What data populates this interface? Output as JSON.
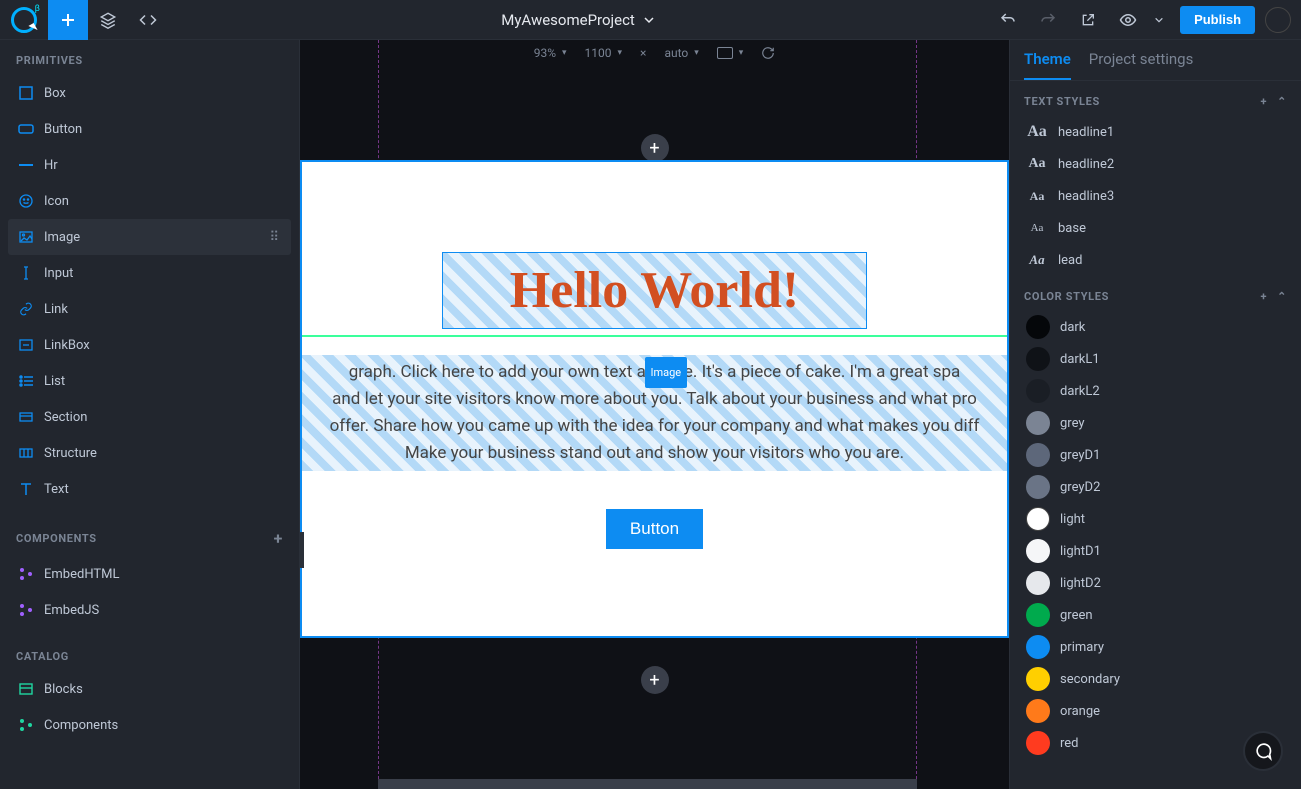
{
  "topbar": {
    "project_name": "MyAwesomeProject",
    "publish_label": "Publish",
    "logo_beta": "β"
  },
  "canvas_toolbar": {
    "zoom": "93%",
    "width": "1100",
    "times": "×",
    "height": "auto"
  },
  "left": {
    "primitives_heading": "PRIMITIVES",
    "components_heading": "COMPONENTS",
    "catalog_heading": "CATALOG",
    "primitives": [
      "Box",
      "Button",
      "Hr",
      "Icon",
      "Image",
      "Input",
      "Link",
      "LinkBox",
      "List",
      "Section",
      "Structure",
      "Text"
    ],
    "components": [
      "EmbedHTML",
      "EmbedJS"
    ],
    "catalog": [
      "Blocks",
      "Components"
    ]
  },
  "canvas": {
    "headline": "Hello World!",
    "drag_label": "Image",
    "paragraph": "graph. Click here to add your own text and           me. It's a piece of cake. I'm a great spa\nand let your site visitors know more about you. Talk about your business and what pro\noffer. Share how you came up with the idea for your company and what makes you diff\nMake your business stand out and show your visitors who you are.",
    "button_label": "Button"
  },
  "right": {
    "tabs": {
      "theme": "Theme",
      "settings": "Project settings"
    },
    "text_styles_heading": "TEXT STYLES",
    "text_styles": [
      "headline1",
      "headline2",
      "headline3",
      "base",
      "lead"
    ],
    "color_styles_heading": "COLOR STYLES",
    "color_styles": [
      {
        "name": "dark",
        "hex": "#05070a"
      },
      {
        "name": "darkL1",
        "hex": "#0f1217"
      },
      {
        "name": "darkL2",
        "hex": "#1a1e25"
      },
      {
        "name": "grey",
        "hex": "#7b8494"
      },
      {
        "name": "greyD1",
        "hex": "#5d677a"
      },
      {
        "name": "greyD2",
        "hex": "#6a7486"
      },
      {
        "name": "light",
        "hex": "#ffffff"
      },
      {
        "name": "lightD1",
        "hex": "#f5f6f8"
      },
      {
        "name": "lightD2",
        "hex": "#e6e8ec"
      },
      {
        "name": "green",
        "hex": "#00aa4d"
      },
      {
        "name": "primary",
        "hex": "#0d8cf2"
      },
      {
        "name": "secondary",
        "hex": "#ffcf00"
      },
      {
        "name": "orange",
        "hex": "#ff7a1a"
      },
      {
        "name": "red",
        "hex": "#ff3b1f"
      }
    ]
  }
}
